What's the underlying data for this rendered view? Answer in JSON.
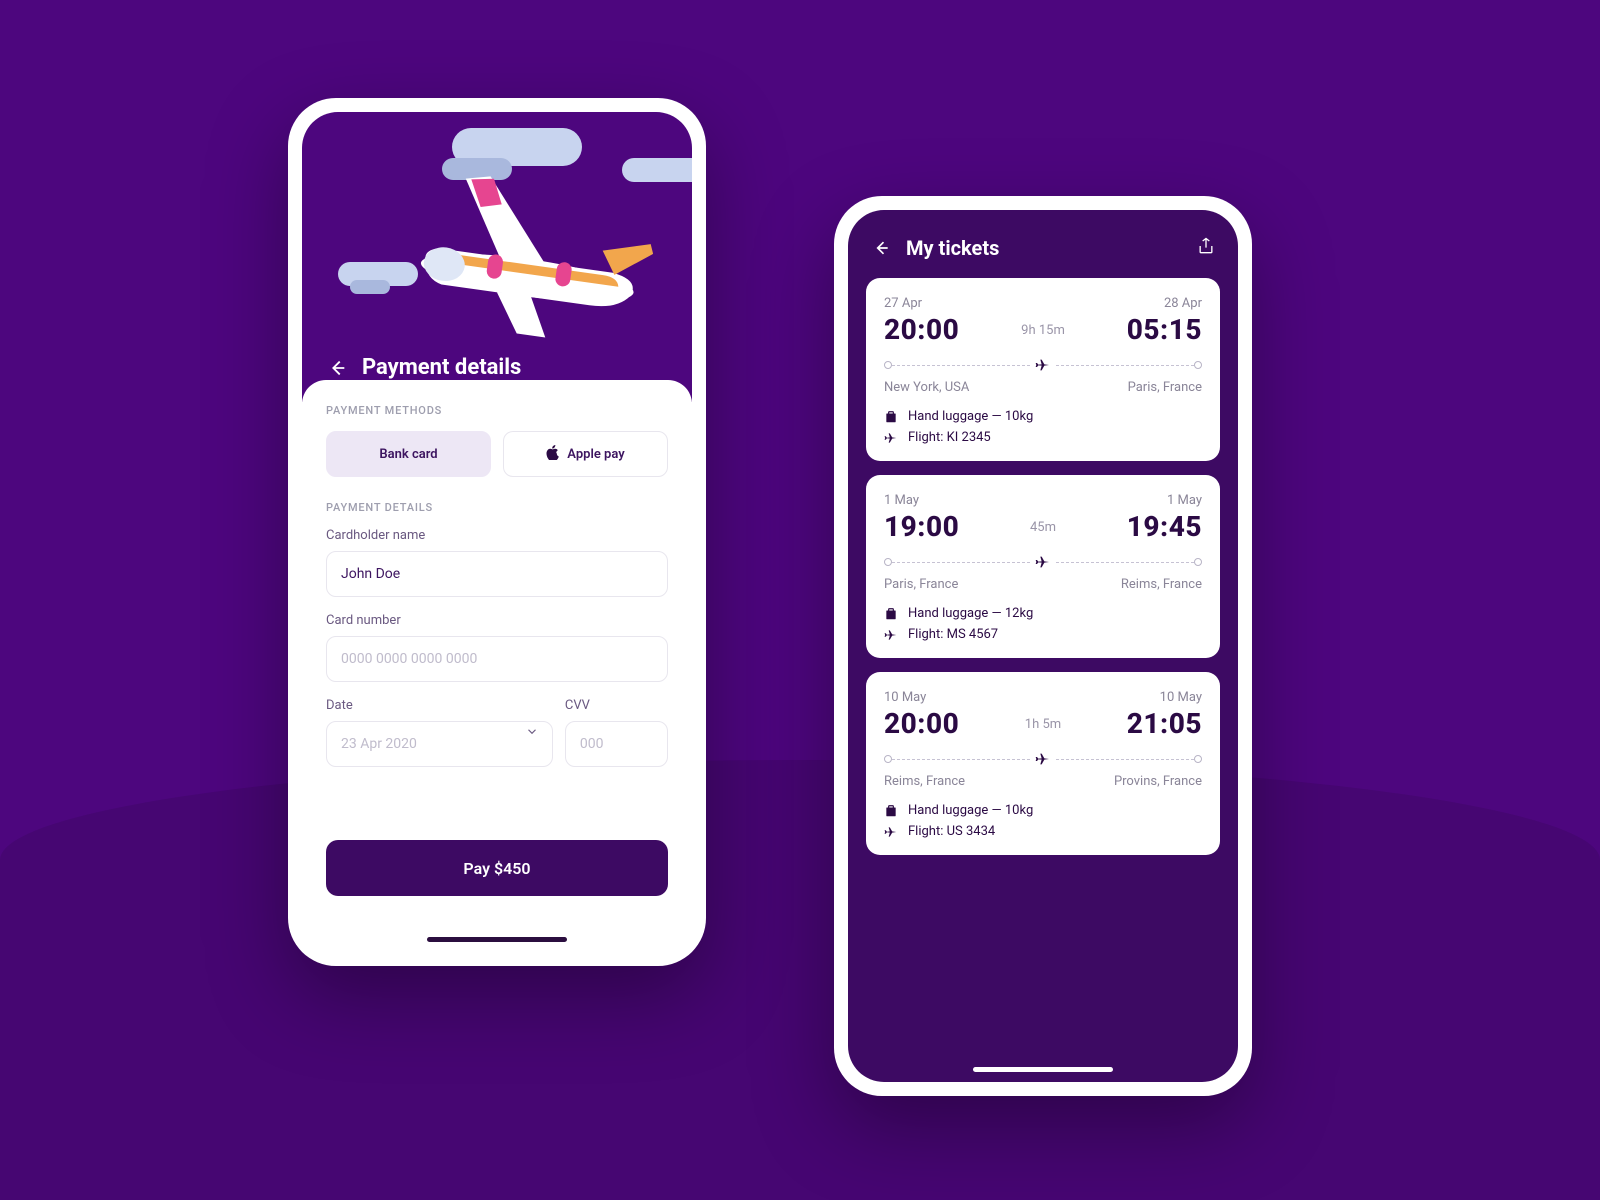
{
  "payment": {
    "title": "Payment details",
    "section_methods": "PAYMENT METHODS",
    "methods": {
      "bank": "Bank card",
      "apple": "Apple pay"
    },
    "section_details": "PAYMENT DETAILS",
    "cardholder_label": "Cardholder name",
    "cardholder_value": "John Doe",
    "cardnumber_label": "Card number",
    "cardnumber_placeholder": "0000 0000 0000 0000",
    "date_label": "Date",
    "date_value": "23 Apr 2020",
    "cvv_label": "CVV",
    "cvv_placeholder": "000",
    "pay_button": "Pay $450"
  },
  "tickets": {
    "title": "My tickets",
    "items": [
      {
        "dep_date": "27 Apr",
        "dep_time": "20:00",
        "duration": "9h 15m",
        "arr_date": "28 Apr",
        "arr_time": "05:15",
        "from": "New York, USA",
        "to": "Paris, France",
        "luggage": "Hand luggage — 10kg",
        "flight": "Flight: KI 2345"
      },
      {
        "dep_date": "1 May",
        "dep_time": "19:00",
        "duration": "45m",
        "arr_date": "1 May",
        "arr_time": "19:45",
        "from": "Paris, France",
        "to": "Reims, France",
        "luggage": "Hand luggage — 12kg",
        "flight": "Flight: MS 4567"
      },
      {
        "dep_date": "10 May",
        "dep_time": "20:00",
        "duration": "1h 5m",
        "arr_date": "10 May",
        "arr_time": "21:05",
        "from": "Reims, France",
        "to": "Provins, France",
        "luggage": "Hand luggage — 10kg",
        "flight": "Flight: US 3434"
      }
    ]
  }
}
